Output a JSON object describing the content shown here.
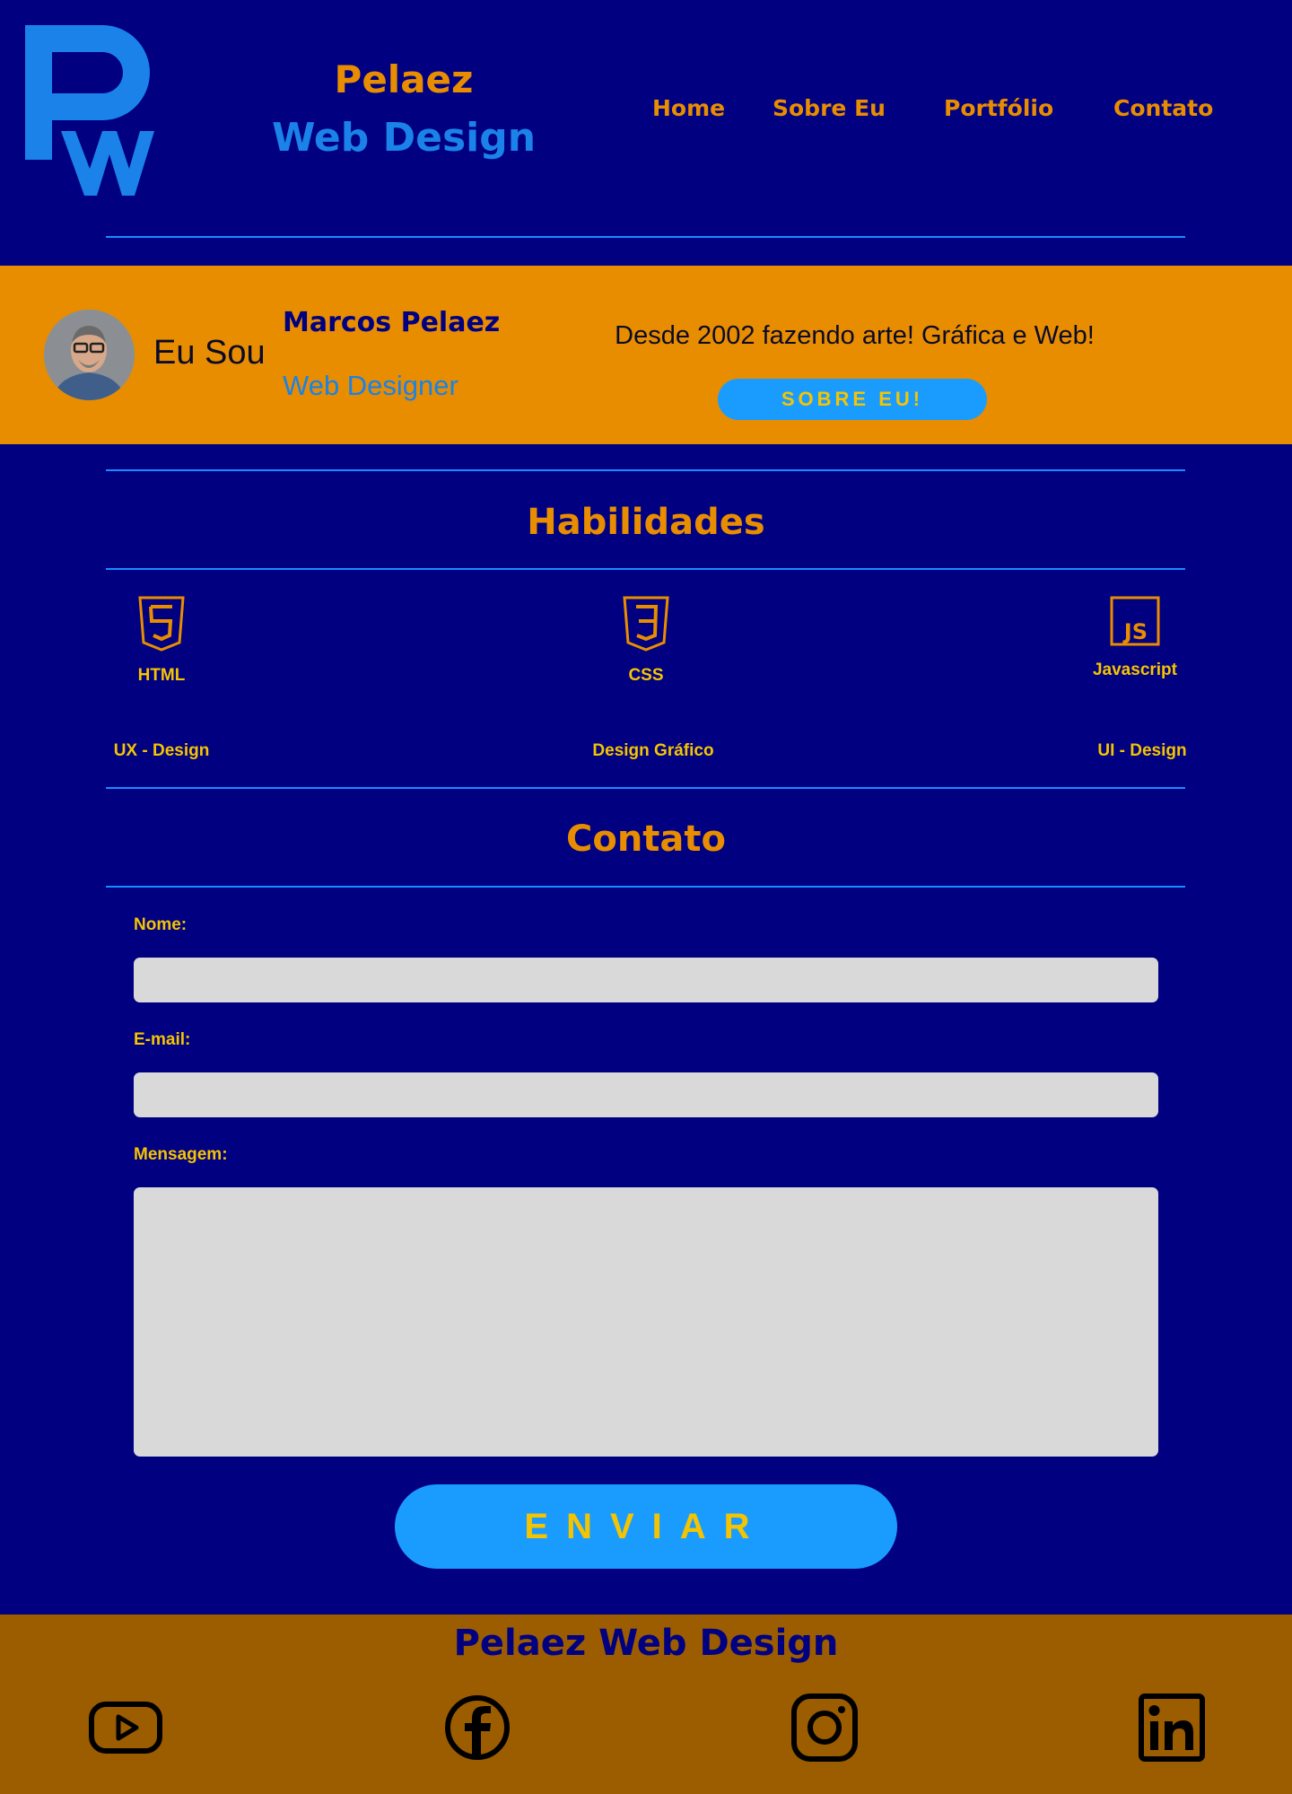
{
  "header": {
    "brand_line1": "Pelaez",
    "brand_line2": "Web Design",
    "nav": [
      "Home",
      "Sobre Eu",
      "Portfólio",
      "Contato"
    ]
  },
  "hero": {
    "intro": "Eu Sou",
    "name": "Marcos Pelaez",
    "role": "Web Designer",
    "tagline": "Desde 2002 fazendo arte! Gráfica e Web!",
    "button": "SOBRE EU!"
  },
  "skills": {
    "title": "Habilidades",
    "items": [
      "HTML",
      "CSS",
      "Javascript",
      "UX - Design",
      "Design Gráfico",
      "UI - Design"
    ]
  },
  "contact": {
    "title": "Contato",
    "name_label": "Nome:",
    "email_label": "E-mail:",
    "message_label": "Mensagem:",
    "send_button": "ENVIAR"
  },
  "footer": {
    "brand": "Pelaez Web Design",
    "social_icons": [
      "youtube-icon",
      "facebook-icon",
      "instagram-icon",
      "linkedin-icon"
    ]
  },
  "colors": {
    "background": "#000080",
    "accent_orange": "#e88d00",
    "accent_blue": "#1a82e8",
    "button_blue": "#1a9cff",
    "label_yellow": "#f5c400",
    "footer_brown": "#9c5c00"
  }
}
